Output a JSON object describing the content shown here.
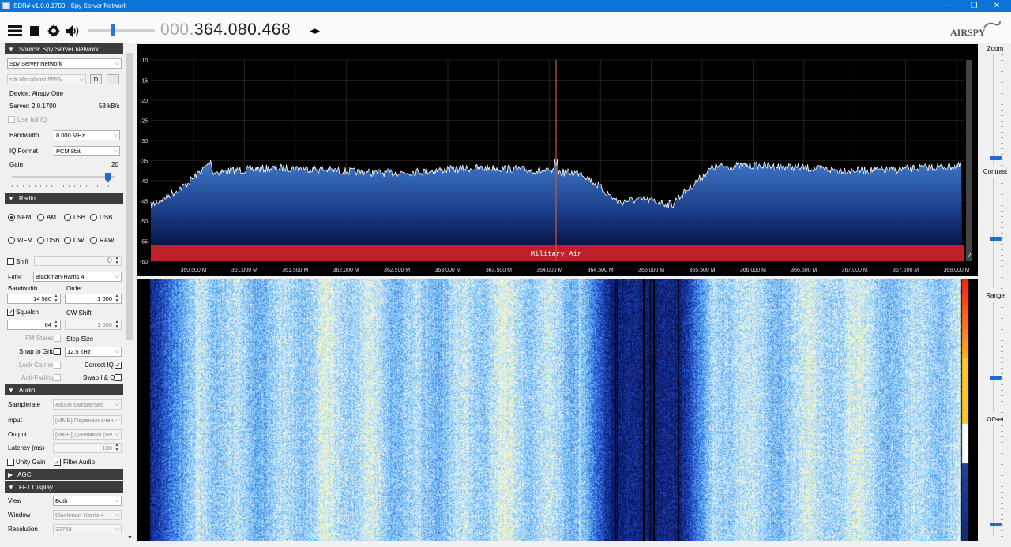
{
  "window": {
    "title": "SDR# v1.0.0.1700 - Spy Server Network",
    "controls": [
      "—",
      "❐",
      "✕"
    ]
  },
  "toolbar": {
    "freq_dim": "000.",
    "freq_main": "364.080.468",
    "freq_arrows": "◂▸",
    "logo": "AIRSPY"
  },
  "source": {
    "header": "Source: Spy Server Network",
    "type": "Spy Server Network",
    "uri": "sdr://localhost:5555/",
    "disconnect_btn": "D",
    "more_btn": "...",
    "device": "Device: Airspy One",
    "server": "Server: 2.0.1700",
    "rate": "58 kB/s",
    "use_full_iq": "Use full IQ",
    "bandwidth_label": "Bandwidth",
    "bandwidth": "8.000 MHz",
    "iq_format_label": "IQ Format",
    "iq_format": "PCM 8bit",
    "gain_label": "Gain",
    "gain": "20"
  },
  "radio": {
    "header": "Radio",
    "modes": [
      "NFM",
      "AM",
      "LSB",
      "USB",
      "WFM",
      "DSB",
      "CW",
      "RAW"
    ],
    "selected_mode": "NFM",
    "shift_label": "Shift",
    "shift": "0",
    "filter_label": "Filter",
    "filter": "Blackman-Harris 4",
    "bandwidth_label": "Bandwidth",
    "order_label": "Order",
    "bandwidth": "14 580",
    "order": "1 000",
    "squelch_label": "Squelch",
    "cw_shift_label": "CW Shift",
    "squelch": "64",
    "cw_shift": "1 000",
    "fm_stereo": "FM Stereo",
    "step_size_label": "Step Size",
    "snap_to_grid": "Snap to Grid",
    "step_size": "12.5 kHz",
    "lock_carrier": "Lock Carrier",
    "correct_iq": "Correct IQ",
    "anti_fading": "Anti-Fading",
    "swap_iq": "Swap I & Q"
  },
  "audio": {
    "header": "Audio",
    "samplerate_label": "Samplerate",
    "samplerate": "48000 sample/sec",
    "input_label": "Input",
    "input": "[MME] Переназначен",
    "output_label": "Output",
    "output": "[MME] Динамики (Re",
    "latency_label": "Latency (ms)",
    "latency": "100",
    "unity_gain": "Unity Gain",
    "filter_audio": "Filter Audio"
  },
  "agc": {
    "header": "AGC"
  },
  "fft_display": {
    "header": "FFT Display",
    "view_label": "View",
    "view": "Both",
    "window_label": "Window",
    "window": "Blackman-Harris 4",
    "resolution_label": "Resolution",
    "resolution": "32768"
  },
  "right": {
    "zoom": "Zoom",
    "contrast": "Contrast",
    "range": "Range",
    "offset": "Offset"
  },
  "spectrum": {
    "y_ticks": [
      "-10",
      "-15",
      "-20",
      "-25",
      "-30",
      "-35",
      "-40",
      "-45",
      "-50",
      "-55",
      "-60"
    ],
    "x_ticks": [
      "360,500 M",
      "361,000 M",
      "361,500 M",
      "362,000 M",
      "362,500 M",
      "363,000 M",
      "363,500 M",
      "364,000 M",
      "364,500 M",
      "365,000 M",
      "365,500 M",
      "366,000 M",
      "366,500 M",
      "367,000 M",
      "367,500 M",
      "368,000 M"
    ],
    "band_label": "Military Air",
    "corner_label": "2",
    "colors": {
      "band": "#c0202a",
      "trace": "#ffffff",
      "fill_top": "#3f79c8",
      "tuner": "#c85a3c"
    }
  }
}
